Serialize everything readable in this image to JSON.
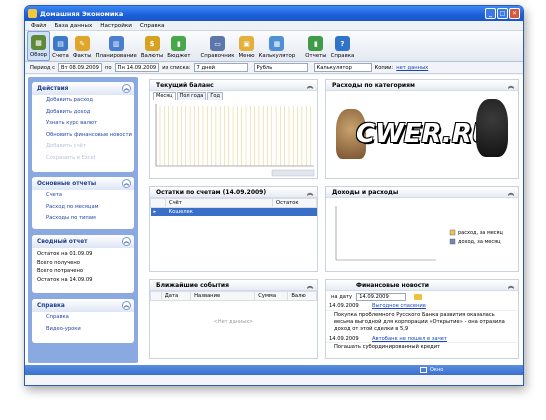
{
  "window": {
    "title": "Домашняя Экономика"
  },
  "menu": [
    "Файл",
    "База данных",
    "Настройки",
    "Справка"
  ],
  "toolbar": [
    {
      "label": "Обзор",
      "icon": "overview-icon",
      "color": "#5e8a37",
      "glyph": "▦",
      "active": true
    },
    {
      "label": "Счета",
      "icon": "accounts-icon",
      "color": "#3c79c8",
      "glyph": "▤"
    },
    {
      "label": "Факты",
      "icon": "facts-icon",
      "color": "#e0a62a",
      "glyph": "✎"
    },
    {
      "label": "Планирование",
      "icon": "calendar-icon",
      "color": "#4a7fd0",
      "glyph": "▥"
    },
    {
      "label": "Валюты",
      "icon": "currency-icon",
      "color": "#d7a21d",
      "glyph": "$"
    },
    {
      "label": "Бюджет",
      "icon": "budget-icon",
      "color": "#46a848",
      "glyph": "▮"
    },
    {
      "label": "Справочник",
      "icon": "directory-icon",
      "color": "#5b76a8",
      "glyph": "▭"
    },
    {
      "label": "Меню",
      "icon": "menu-icon",
      "color": "#e3b03a",
      "glyph": "▣"
    },
    {
      "label": "Калькулятор",
      "icon": "calculator-icon",
      "color": "#4f8fd6",
      "glyph": "▦"
    },
    {
      "label": "Отчеты",
      "icon": "reports-icon",
      "color": "#3e9b46",
      "glyph": "▮"
    },
    {
      "label": "Справка",
      "icon": "help-icon",
      "color": "#2f74c9",
      "glyph": "?"
    }
  ],
  "filter": {
    "period_label": "Период с",
    "date_from": "Вт 08.09.2009",
    "to_label": "по",
    "date_to": "Пн 14.09.2009",
    "list_label": "из списка:",
    "list_value": "7 дней",
    "currency": "Рубль",
    "calc": "Калькулятор",
    "copies_label": "Копии:",
    "copies_value": "нет данных"
  },
  "sidebar": {
    "actions": {
      "title": "Действия",
      "items": [
        "Добавить расход",
        "Добавить доход",
        "Узнать курс валют",
        "Обновить финансовые новости",
        "Добавить счёт",
        "Сохранить в Excel"
      ],
      "disabled": [
        4,
        5
      ]
    },
    "reports": {
      "title": "Основные отчеты",
      "items": [
        "Счета",
        "Расход по месяцам",
        "Расходы по типам"
      ]
    },
    "summary": {
      "title": "Сводный отчет",
      "items": [
        "Остаток на 01.09.09",
        "Всего получено",
        "Всего потрачено",
        "Остаток на 14.09.09"
      ]
    },
    "help": {
      "title": "Справка",
      "items": [
        "Справка",
        "Видео-уроки"
      ]
    }
  },
  "balance": {
    "title": "Текущий баланс",
    "tabs": [
      "Месяц",
      "Пол года",
      "Год"
    ]
  },
  "expenses": {
    "title": "Расходы по категориям",
    "watermark": "CWER.RU"
  },
  "accounts": {
    "title": "Остатки по счетам (14.09.2009)",
    "cols": [
      "Счёт",
      "Остаток"
    ],
    "rows": [
      [
        "Кошелек",
        ""
      ]
    ]
  },
  "incexp": {
    "title": "Доходы и расходы",
    "legend": [
      {
        "label": "расход, за месяц",
        "color": "#e6c15a"
      },
      {
        "label": "доход, за месяц",
        "color": "#6d89b8"
      }
    ]
  },
  "events": {
    "title": "Ближайшие события",
    "cols": [
      "Дата",
      "Название",
      "Сумма",
      "Валю"
    ],
    "empty": "<Нет данных>"
  },
  "news": {
    "title": "Финансовые новости",
    "date_label": "на дату",
    "date_value": "14.09.2009",
    "items": [
      {
        "date": "14.09.2009",
        "title": "Выгодное спасение",
        "text": "Покупка проблемного Русского Банка развития оказалась весьма выгодной для корпорации «Открытие» - она отразила доход от этой сделки в 5,9"
      },
      {
        "date": "14.09.2009",
        "title": "Автобанк не пошел в зачет",
        "text": "Погашать субординированный кредит"
      }
    ]
  },
  "status": {
    "text": "Окно"
  }
}
